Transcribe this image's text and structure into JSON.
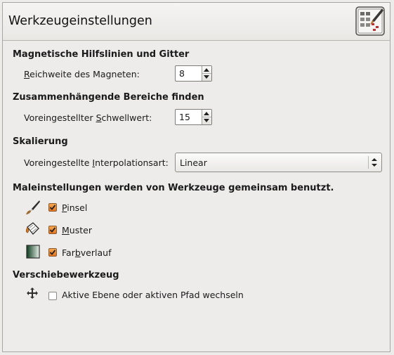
{
  "header": {
    "title": "Werkzeugeinstellungen",
    "icon": "tool-options-icon"
  },
  "magnetic": {
    "heading": "Magnetische Hilfslinien und Gitter",
    "label_prefix": "",
    "label_underline": "R",
    "label_rest": "eichweite des Magneten:",
    "value": "8"
  },
  "threshold": {
    "heading": "Zusammenhängende Bereiche finden",
    "label_prefix": "Voreingestellter ",
    "label_underline": "S",
    "label_rest": "chwellwert:",
    "value": "15"
  },
  "scaling": {
    "heading": "Skalierung",
    "label_prefix": "Voreingestellte ",
    "label_underline": "I",
    "label_rest": "nterpolationsart:",
    "value": "Linear"
  },
  "paint": {
    "heading": "Maleinstellungen werden von Werkzeuge gemeinsam benutzt.",
    "items": [
      {
        "prefix": "",
        "underline": "P",
        "rest": "insel",
        "checked": true,
        "icon": "brush-icon"
      },
      {
        "prefix": "",
        "underline": "M",
        "rest": "uster",
        "checked": true,
        "icon": "pattern-bucket-icon"
      },
      {
        "prefix": "Far",
        "underline": "b",
        "rest": "verlauf",
        "checked": true,
        "icon": "gradient-icon"
      }
    ]
  },
  "move": {
    "heading": "Verschiebewerkzeug",
    "label": "Aktive Ebene oder aktiven Pfad wechseln",
    "checked": false,
    "icon": "move-arrows-icon"
  }
}
